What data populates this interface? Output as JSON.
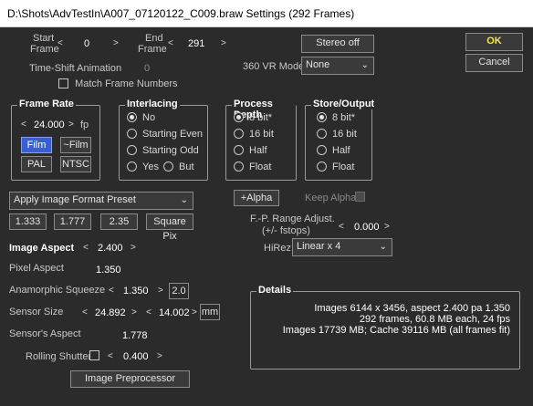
{
  "window": {
    "title": "D:\\Shots\\AdvTestIn\\A007_07120122_C009.braw Settings (292 Frames)"
  },
  "frames": {
    "start_label_1": "Start",
    "start_label_2": "Frame",
    "start_value": "0",
    "end_label_1": "End",
    "end_label_2": "Frame",
    "end_value": "291",
    "timeshift_label": "Time-Shift Animation",
    "timeshift_value": "0",
    "match_label": "Match Frame Numbers"
  },
  "stereo_button": "Stereo off",
  "vr": {
    "label": "360 VR Mode",
    "value": "None"
  },
  "ok_button": "OK",
  "cancel_button": "Cancel",
  "frame_rate": {
    "title": "Frame Rate",
    "value": "24.000",
    "unit": "fp",
    "buttons": {
      "film": "Film",
      "approx_film": "~Film",
      "pal": "PAL",
      "ntsc": "NTSC"
    }
  },
  "interlacing": {
    "title": "Interlacing",
    "options": [
      "No",
      "Starting Even",
      "Starting Odd"
    ],
    "yes": "Yes",
    "but": "But",
    "selected": 0
  },
  "process_depth": {
    "title": "Process Depth",
    "options": [
      "8 bit*",
      "16 bit",
      "Half",
      "Float"
    ],
    "selected": 0
  },
  "store_output": {
    "title": "Store/Output",
    "options": [
      "8 bit*",
      "16 bit",
      "Half",
      "Float"
    ],
    "selected": 0
  },
  "preset": {
    "combo": "Apply Image Format Preset",
    "buttons": [
      "1.333",
      "1.777",
      "2.35",
      "Square Pix"
    ]
  },
  "alpha": {
    "plus_alpha": "+Alpha",
    "keep_alpha": "Keep Alpha"
  },
  "fp_range": {
    "label_1": "F.-P. Range Adjust.",
    "label_2": "(+/- fstops)",
    "value": "0.000"
  },
  "hirez": {
    "label": "HiRez",
    "value": "Linear x 4"
  },
  "image": {
    "aspect_label": "Image Aspect",
    "aspect_value": "2.400",
    "pixel_aspect_label": "Pixel Aspect",
    "pixel_aspect_value": "1.350",
    "anamorphic_label": "Anamorphic Squeeze",
    "anamorphic_value": "1.350",
    "anamorphic_box": "2.0",
    "sensor_size_label": "Sensor Size",
    "sensor_w": "24.892",
    "sensor_h": "14.002",
    "sensor_unit": "mm",
    "sensor_aspect_label": "Sensor's Aspect",
    "sensor_aspect_value": "1.778",
    "rolling_label": "Rolling Shutter",
    "rolling_value": "0.400",
    "preprocessor_button": "Image Preprocessor"
  },
  "details": {
    "title": "Details",
    "lines": [
      "Images 6144 x 3456, aspect 2.400 pa 1.350",
      "292 frames, 60.8 MB each, 24 fps",
      "Images 17739 MB; Cache 39116 MB (all frames fit)"
    ]
  }
}
